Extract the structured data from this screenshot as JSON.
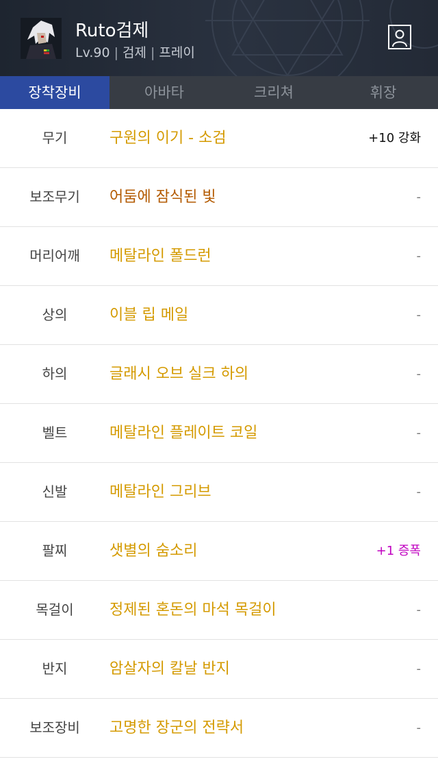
{
  "profile": {
    "name": "Ruto검제",
    "level": "Lv.90",
    "job": "검제",
    "job_detail": "프레이"
  },
  "tabs": [
    {
      "label": "장착장비",
      "active": true
    },
    {
      "label": "아바타",
      "active": false
    },
    {
      "label": "크리쳐",
      "active": false
    },
    {
      "label": "휘장",
      "active": false
    }
  ],
  "equipment": [
    {
      "slot": "무기",
      "item": "구원의 이기 - 소검",
      "rarity": "legendary",
      "extra": "+10 강화"
    },
    {
      "slot": "보조무기",
      "item": "어둠에 잠식된 빛",
      "rarity": "epic",
      "extra": "-"
    },
    {
      "slot": "머리어깨",
      "item": "메탈라인 폴드런",
      "rarity": "legendary",
      "extra": "-"
    },
    {
      "slot": "상의",
      "item": "이블 립 메일",
      "rarity": "legendary",
      "extra": "-"
    },
    {
      "slot": "하의",
      "item": "글래시 오브 실크 하의",
      "rarity": "legendary",
      "extra": "-"
    },
    {
      "slot": "벨트",
      "item": "메탈라인 플레이트 코일",
      "rarity": "legendary",
      "extra": "-"
    },
    {
      "slot": "신발",
      "item": "메탈라인 그리브",
      "rarity": "legendary",
      "extra": "-"
    },
    {
      "slot": "팔찌",
      "item": "샛별의 숨소리",
      "rarity": "legendary",
      "extra": "+1 증폭"
    },
    {
      "slot": "목걸이",
      "item": "정제된 혼돈의 마석 목걸이",
      "rarity": "legendary",
      "extra": "-"
    },
    {
      "slot": "반지",
      "item": "암살자의 칼날 반지",
      "rarity": "legendary",
      "extra": "-"
    },
    {
      "slot": "보조장비",
      "item": "고명한 장군의 전략서",
      "rarity": "legendary",
      "extra": "-"
    }
  ],
  "colors": {
    "header_bg": "#262d38",
    "active_tab": "#2c4aa0",
    "legendary": "#d49a00",
    "epic": "#b35a00",
    "amplify": "#c000c0"
  },
  "icons": {
    "profile": "person-icon",
    "avatar": "character-portrait"
  }
}
